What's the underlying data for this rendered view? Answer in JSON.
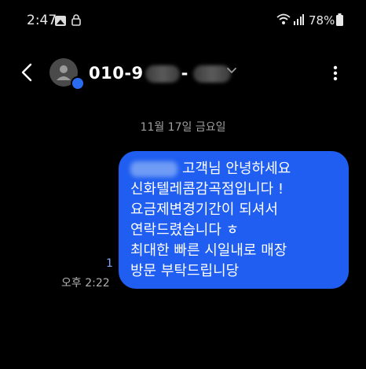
{
  "status_bar": {
    "time": "2:47",
    "battery_percent": "78%",
    "icons": [
      "gallery-icon",
      "lock-icon",
      "wifi-icon",
      "signal-icon",
      "battery-icon"
    ]
  },
  "header": {
    "contact_prefix": "010-9",
    "contact_separator": "-",
    "icons": [
      "back-icon",
      "avatar-person-icon",
      "chevron-down-icon",
      "more-vertical-icon"
    ]
  },
  "conversation": {
    "date_label": "11월 17일 금요일",
    "message": {
      "lines": [
        "고객님 안녕하세요",
        "신화텔레콤감곡점입니다 !",
        "요금제변경기간이 되셔서",
        "연락드렸습니다 ㅎ",
        "최대한 빠른 시일내로 매장",
        "방문 부탁드립니당"
      ],
      "read_count": "1",
      "time": "오후 2:22"
    }
  },
  "colors": {
    "background": "#000000",
    "bubble": "#1f5ef0",
    "badge": "#2a6cf0"
  }
}
